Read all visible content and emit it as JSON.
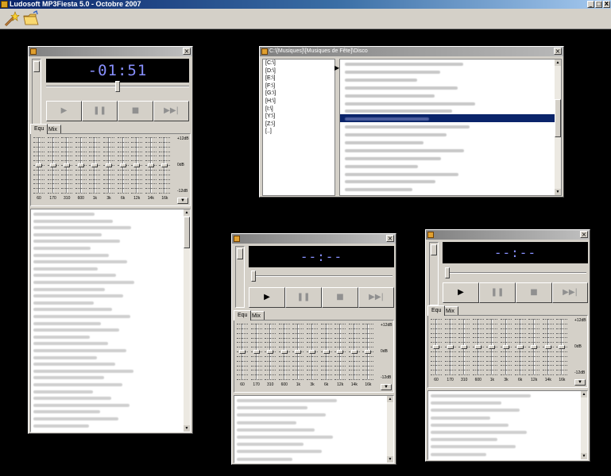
{
  "app": {
    "title": "Ludosoft MP3Fiesta 5.0 - Octobre 2007"
  },
  "titlebar_buttons": [
    "_",
    "□",
    "X"
  ],
  "toolbar": {
    "tools": [
      "magic-wand-icon",
      "open-folder-icon"
    ]
  },
  "player1": {
    "time": "-01:51",
    "seek_progress": 0.5,
    "volume_level": 1.0,
    "controls": {
      "play": "▶",
      "pause": "❚❚",
      "stop": "■",
      "next": "▶▶|"
    },
    "controls_enabled": false,
    "tabs": [
      "Equ",
      "Mix"
    ],
    "selected_tab": "Equ",
    "eq": {
      "bands": [
        "60",
        "170",
        "310",
        "600",
        "1k",
        "3k",
        "6k",
        "12k",
        "14k",
        "16k"
      ],
      "levels": [
        0,
        0,
        0,
        0,
        0,
        0,
        0,
        0,
        0,
        0
      ],
      "db_labels": [
        "+12dB",
        "0dB",
        "-12dB"
      ]
    },
    "playlist_rows": 32,
    "scroll_position": 0.05
  },
  "player2": {
    "time": "--:--",
    "seek_progress": 0.0,
    "volume_level": 1.0,
    "controls": {
      "play": "▶",
      "pause": "❚❚",
      "stop": "■",
      "next": "▶▶|"
    },
    "tabs": [
      "Equ",
      "Mix"
    ],
    "selected_tab": "Equ",
    "eq": {
      "bands": [
        "60",
        "170",
        "310",
        "600",
        "1k",
        "3k",
        "6k",
        "12k",
        "14k",
        "16k"
      ],
      "levels": [
        0,
        0,
        0,
        0,
        0,
        0,
        0,
        0,
        0,
        0
      ],
      "db_labels": [
        "+12dB",
        "0dB",
        "-12dB"
      ]
    },
    "playlist_rows": 9
  },
  "player3": {
    "time": "--:--",
    "seek_progress": 0.0,
    "volume_level": 1.0,
    "controls": {
      "play": "▶",
      "pause": "❚❚",
      "stop": "■",
      "next": "▶▶|"
    },
    "tabs": [
      "Equ",
      "Mix"
    ],
    "selected_tab": "Equ",
    "eq": {
      "bands": [
        "60",
        "170",
        "310",
        "600",
        "1k",
        "3k",
        "6k",
        "12k",
        "14k",
        "16k"
      ],
      "levels": [
        0,
        0,
        0,
        0,
        0,
        0,
        0,
        0,
        0,
        0
      ],
      "db_labels": [
        "+12dB",
        "0dB",
        "-12dB"
      ]
    },
    "playlist_rows": 9
  },
  "browser": {
    "path": "C:\\[Musiques]\\[Musiques de Fête]\\Disco",
    "drives": [
      "[C:\\]",
      "[D:\\]",
      "[E:\\]",
      "[F:\\]",
      "[G:\\]",
      "[H:\\]",
      "[I:\\]",
      "[Y:\\]",
      "[Z:\\]",
      "[..]"
    ],
    "file_rows": 17,
    "selected_row": 9
  }
}
